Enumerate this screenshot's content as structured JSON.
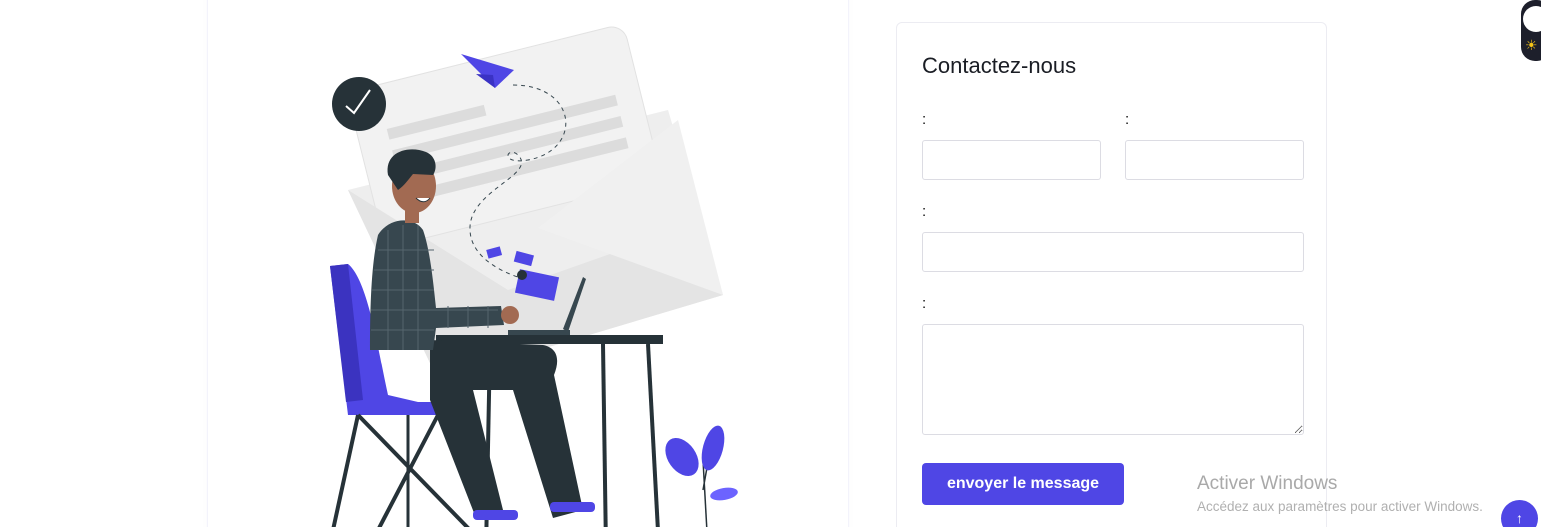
{
  "contact": {
    "title": "Contactez-nous",
    "labels": {
      "first": ":",
      "second": ":",
      "third": ":",
      "message": ":"
    },
    "inputs": {
      "first_value": "",
      "second_value": "",
      "third_value": "",
      "message_value": ""
    },
    "submit_label": "envoyer le message"
  },
  "watermark": {
    "title": "Activer Windows",
    "subtitle": "Accédez aux paramètres pour activer Windows."
  },
  "icons": {
    "scroll_top": "arrow-up-icon",
    "theme_toggle": "sun-icon"
  },
  "colors": {
    "accent": "#4f46e5",
    "dark": "#263238",
    "toggle_bg": "#1d1f2b"
  }
}
